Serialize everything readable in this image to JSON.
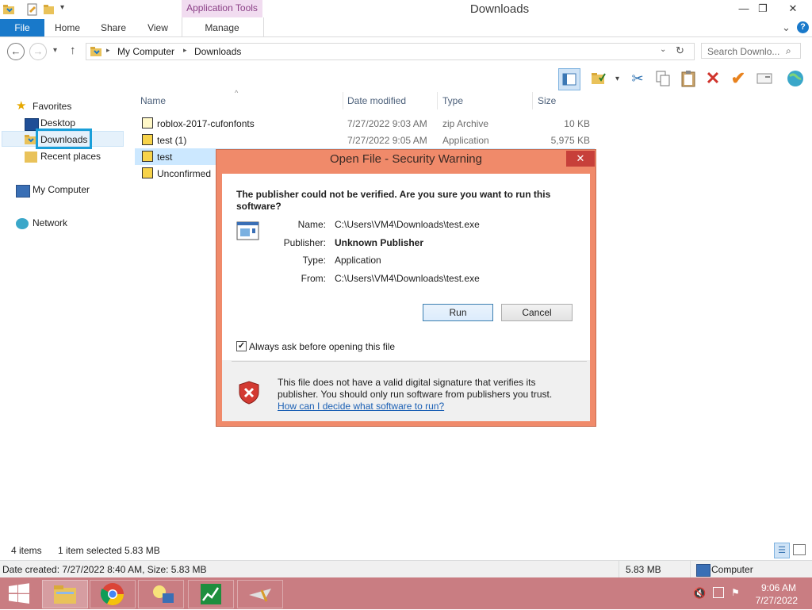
{
  "window": {
    "title": "Downloads",
    "contextual_tab_group": "Application Tools",
    "controls": {
      "minimize": "—",
      "maximize": "❐",
      "close": "✕"
    }
  },
  "ribbon": {
    "tabs": [
      "File",
      "Home",
      "Share",
      "View",
      "Manage"
    ],
    "collapse": "⌄",
    "help": "?"
  },
  "address": {
    "path": [
      "My Computer",
      "Downloads"
    ],
    "search_placeholder": "Search Downlo..."
  },
  "navigation": {
    "favorites_label": "Favorites",
    "favorites": [
      "Desktop",
      "Downloads",
      "Recent places"
    ],
    "computer": "My Computer",
    "network": "Network"
  },
  "columns": [
    "Name",
    "Date modified",
    "Type",
    "Size"
  ],
  "files": [
    {
      "name": "roblox-2017-cufonfonts",
      "date": "7/27/2022 9:03 AM",
      "type": "zip Archive",
      "size": "10 KB"
    },
    {
      "name": "test (1)",
      "date": "7/27/2022 9:05 AM",
      "type": "Application",
      "size": "5,975 KB"
    },
    {
      "name": "test",
      "date": "",
      "type": "",
      "size": ""
    },
    {
      "name": "Unconfirmed",
      "date": "",
      "type": "",
      "size": ""
    }
  ],
  "status": {
    "items": "4 items",
    "selected": "1 item selected  5.83 MB",
    "details": "Date created: 7/27/2022 8:40 AM, Size: 5.83 MB",
    "size": "5.83 MB",
    "location": "Computer"
  },
  "dialog": {
    "title": "Open File - Security Warning",
    "question": "The publisher could not be verified.  Are you sure you want to run this software?",
    "fields": [
      {
        "label": "Name:",
        "value": "C:\\Users\\VM4\\Downloads\\test.exe"
      },
      {
        "label": "Publisher:",
        "value": "Unknown Publisher"
      },
      {
        "label": "Type:",
        "value": "Application"
      },
      {
        "label": "From:",
        "value": "C:\\Users\\VM4\\Downloads\\test.exe"
      }
    ],
    "run_label": "Run",
    "cancel_label": "Cancel",
    "checkbox_label": "Always ask before opening this file",
    "checkbox_checked": true,
    "warning_text": "This file does not have a valid digital signature that verifies its publisher.  You should only run software from publishers you trust.",
    "help_link": "How can I decide what software to run?"
  },
  "taskbar": {
    "time": "9:06 AM",
    "date": "7/27/2022"
  },
  "colors": {
    "accent": "#1979ca",
    "dialog_frame": "#f08a6a",
    "taskbar": "#c97d82",
    "selection_outline": "#1a9fd9",
    "link": "#1a5fb4"
  }
}
